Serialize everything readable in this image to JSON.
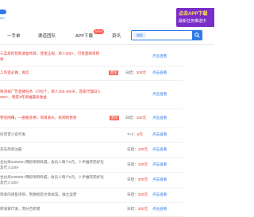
{
  "header": {
    "logo_sub": "om",
    "promo_line1": "点击APP下载",
    "promo_line2": "最新任务推送中"
  },
  "nav": {
    "items": [
      "一手单",
      "渠道团队",
      "APP下载",
      "资讯"
    ],
    "app_badge": "NEW"
  },
  "search": {
    "category": "搜索",
    "placeholder": ""
  },
  "rows": [
    {
      "lines": [
        "三菜单的智能收益项目，佳佬正规，单人500+，可批量刷单转",
        "收"
      ],
      "color": "red",
      "tag": "",
      "price": "",
      "price_value": "",
      "view": "点击查看"
    },
    {
      "lines": [
        "工作室必做，真实"
      ],
      "color": "red",
      "tag": "置顶",
      "price": "日结：",
      "price_value": "300元",
      "view": "点击查看"
    },
    {
      "lines": [
        "快消视广告直播任务（只拉个，单人200-400天，首家代理日入",
        "000+，稳定3年采推最高收益"
      ],
      "color": "red",
      "tag": "",
      "price": "",
      "price_value": "",
      "view": "点击查看"
    },
    {
      "lines": [
        "零充网赚，一部搬多用，项目丢头，拆网新更新"
      ],
      "color": "red",
      "tag": "置顶",
      "price": "日结：",
      "price_value": "100元",
      "view": "点击查看"
    },
    {
      "lines": [
        "抖音音小说代发"
      ],
      "color": "gray",
      "tag": "",
      "price": "T+1：",
      "price_value": "6元",
      "view": "点击查看"
    },
    {
      "lines": [
        "京东简单注册"
      ],
      "color": "gray",
      "tag": "",
      "price": "日结：",
      "price_value": "100元",
      "view": "点击查看"
    },
    {
      "lines": [
        "合伙商100000+用粉项目商城，会员人每个5元，人手推有完好社",
        "友代入100+"
      ],
      "color": "gray",
      "tag": "",
      "price": "日结：",
      "price_value": "100元",
      "view": "点击查看"
    },
    {
      "lines": [
        "合伙商100000+用粉项目商城，会员人每个5元，人手推有完好社",
        "友代入100+"
      ],
      "color": "gray",
      "tag": "",
      "price": "日结：",
      "price_value": "200元",
      "view": "点击查看"
    },
    {
      "lines": [
        "简单的闲鱼项目，熊圈标签文章关案，独立运营"
      ],
      "color": "gray",
      "tag": "",
      "price": "日结：",
      "price_value": "200元",
      "view": "点击查看"
    },
    {
      "lines": [
        "转发家代发，周分百新建"
      ],
      "color": "gray",
      "tag": "",
      "price": "日结：",
      "price_value": "200元",
      "view": "点击查看"
    }
  ]
}
